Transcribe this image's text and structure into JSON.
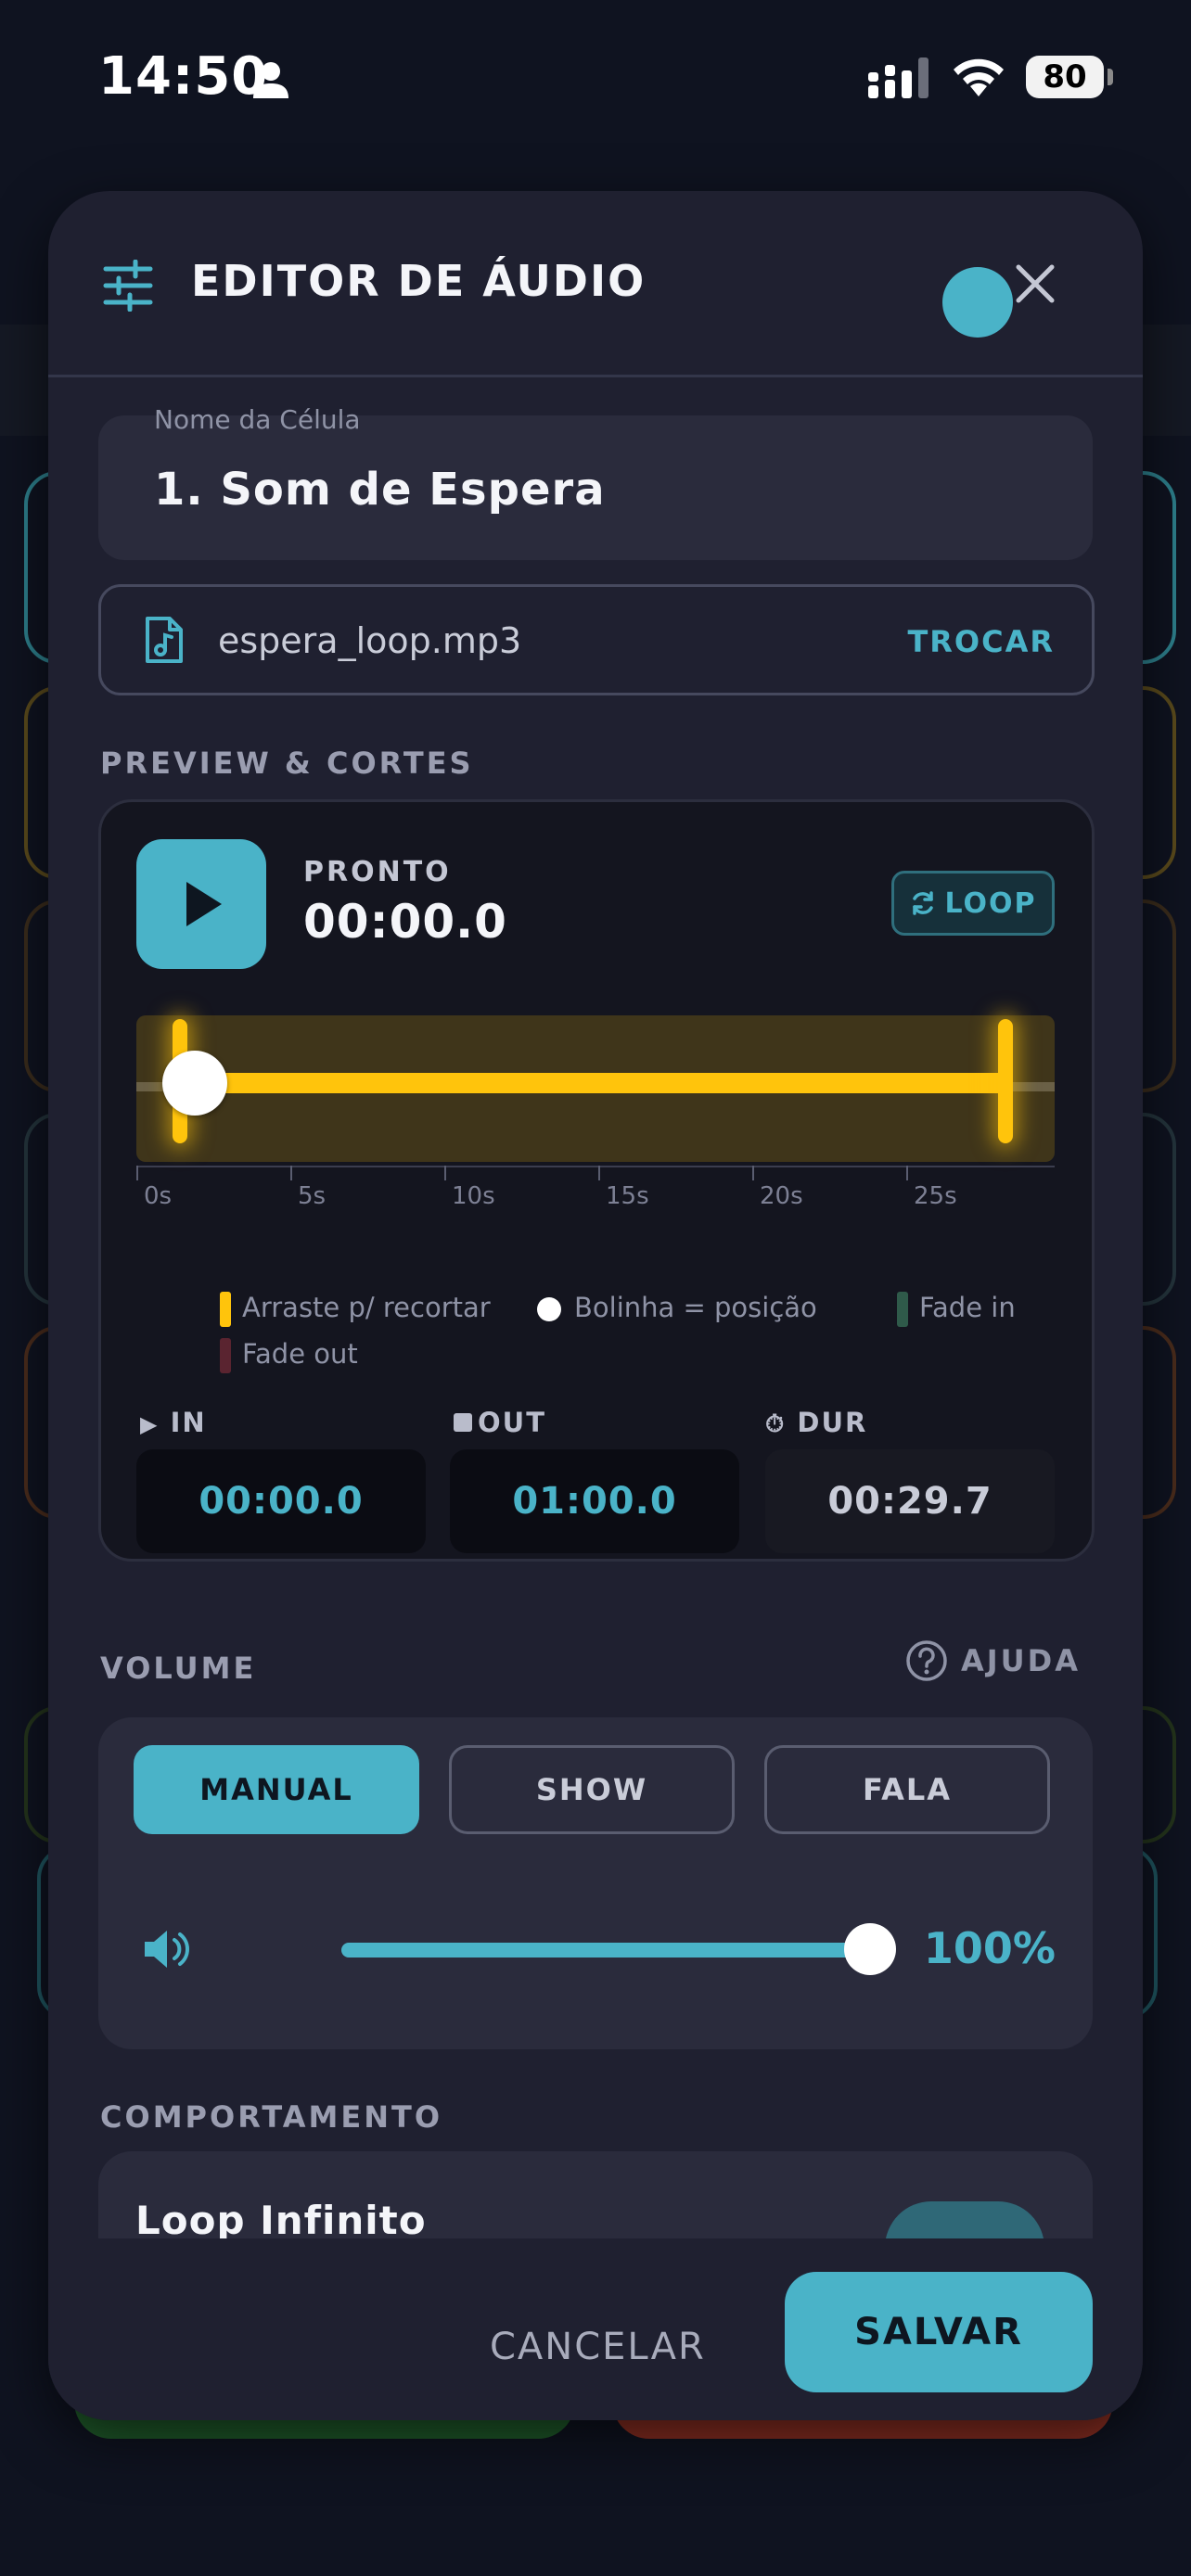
{
  "status_bar": {
    "time": "14:50",
    "battery": "80"
  },
  "modal": {
    "title": "EDITOR DE ÁUDIO",
    "name_field": {
      "label": "Nome da Célula",
      "value": "1. Som de Espera"
    },
    "file": {
      "name": "espera_loop.mp3",
      "action": "TROCAR"
    },
    "preview": {
      "section_title": "PREVIEW & CORTES",
      "state": "PRONTO",
      "time": "00:00.0",
      "loop_label": "LOOP",
      "ticks": [
        "0s",
        "5s",
        "10s",
        "15s",
        "20s",
        "25s"
      ],
      "legend": {
        "trim": "Arraste p/ recortar",
        "position": "Bolinha = posição",
        "fade_in": "Fade in",
        "fade_out": "Fade out"
      },
      "in": {
        "label": "IN",
        "value": "00:00.0"
      },
      "out": {
        "label": "OUT",
        "value": "01:00.0"
      },
      "dur": {
        "label": "DUR",
        "value": "00:29.7"
      }
    },
    "volume": {
      "section_title": "VOLUME",
      "help_label": "AJUDA",
      "modes": [
        "MANUAL",
        "SHOW",
        "FALA"
      ],
      "selected_mode": "MANUAL",
      "level": "100%"
    },
    "behavior": {
      "section_title": "COMPORTAMENTO",
      "loop_title": "Loop Infinito",
      "loop_enabled": true
    },
    "footer": {
      "cancel": "CANCELAR",
      "save": "SALVAR"
    }
  },
  "colors": {
    "accent": "#4ab3c8",
    "trim": "#ffc40c",
    "fade_in": "#2f5a4a",
    "fade_out": "#5a2430"
  }
}
